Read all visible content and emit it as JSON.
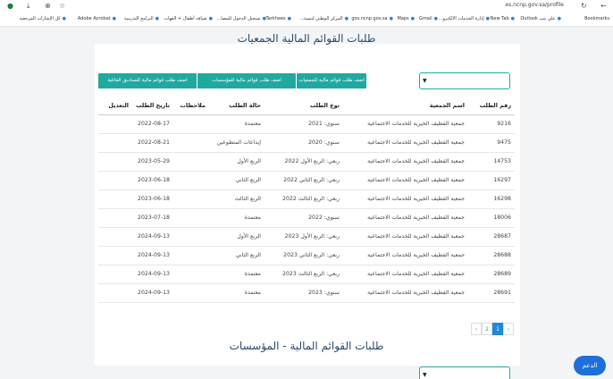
{
  "browser": {
    "url": "es.ncnp.gov.sa/profile",
    "bookmarks": {
      "bookmarks_label": "Bookmarks",
      "items": [
        "علي يتب Outlook",
        "New Tab",
        "إدارة الخدمات الالكترو...",
        "Gmail",
        "Maps",
        "gov.ncnp.gov.sa",
        "المركز الوطني لتنمية...",
        "Tarkhees",
        "تسجيل الدخول للمصا...",
        "ضيافة أطفال + العهات",
        "البرامج التدريبية",
        "Adobe Acrobat"
      ],
      "all_bookmarks": "كل الإشارات المرجعية"
    }
  },
  "section1": {
    "title": "طلبات القوائم المالية الجمعيات",
    "buttons": [
      "اضف طلب قوائم مالية للجمعيات",
      "اضف طلب قوائم مالية للمؤسسات",
      "اضف طلب قوائم مالية للصناديق العائلية"
    ],
    "columns": [
      "رقم الطلب",
      "اسم الجمعية",
      "نوع الطلب",
      "حالة الطلب",
      "ملاحظات",
      "تاريخ الطلب",
      "التعديل"
    ],
    "rows": [
      [
        "9216",
        "جمعية القطيف الخيرية للخدمات الاجتماعية",
        "سنوي: 2021",
        "معتمدة",
        "",
        "2022-08-17",
        ""
      ],
      [
        "9475",
        "جمعية القطيف الخيرية للخدمات الاجتماعية",
        "سنوي: 2020",
        "إيداعات المتطوعين",
        "",
        "2022-08-21",
        ""
      ],
      [
        "14753",
        "جمعية القطيف الخيرية للخدمات الاجتماعية",
        "ربعي: الربع الأول 2022",
        "الربع الأول",
        "",
        "2023-05-29",
        ""
      ],
      [
        "16297",
        "جمعية القطيف الخيرية للخدمات الاجتماعية",
        "ربعي: الربع الثاني 2022",
        "الربع الثاني",
        "",
        "2023-06-18",
        ""
      ],
      [
        "16298",
        "جمعية القطيف الخيرية للخدمات الاجتماعية",
        "ربعي: الربع الثالث 2022",
        "الربع الثالث",
        "",
        "2023-06-18",
        ""
      ],
      [
        "18006",
        "جمعية القطيف الخيرية للخدمات الاجتماعية",
        "سنوي: 2022",
        "معتمدة",
        "",
        "2023-07-18",
        ""
      ],
      [
        "28687",
        "جمعية القطيف الخيرية للخدمات الاجتماعية",
        "ربعي: الربع الأول 2023",
        "الربع الأول",
        "",
        "2024-09-13",
        ""
      ],
      [
        "28688",
        "جمعية القطيف الخيرية للخدمات الاجتماعية",
        "ربعي: الربع الثاني 2023",
        "الربع الثاني",
        "",
        "2024-09-13",
        ""
      ],
      [
        "28689",
        "جمعية القطيف الخيرية للخدمات الاجتماعية",
        "ربعي: الربع الثالث 2023",
        "معتمدة",
        "",
        "2024-09-13",
        ""
      ],
      [
        "28691",
        "جمعية القطيف الخيرية للخدمات الاجتماعية",
        "سنوي: 2023",
        "معتمدة",
        "",
        "2024-09-13",
        ""
      ]
    ],
    "pagination": [
      "‹",
      "1",
      "2",
      "›"
    ],
    "active_page": "1"
  },
  "section2": {
    "title": "طلبات القوائم المالية - المؤسسات"
  },
  "help_button": "الدعم",
  "colors": {
    "accent": "#1fa9a1",
    "primary": "#1e6fd9",
    "title": "#2b4b6f"
  }
}
